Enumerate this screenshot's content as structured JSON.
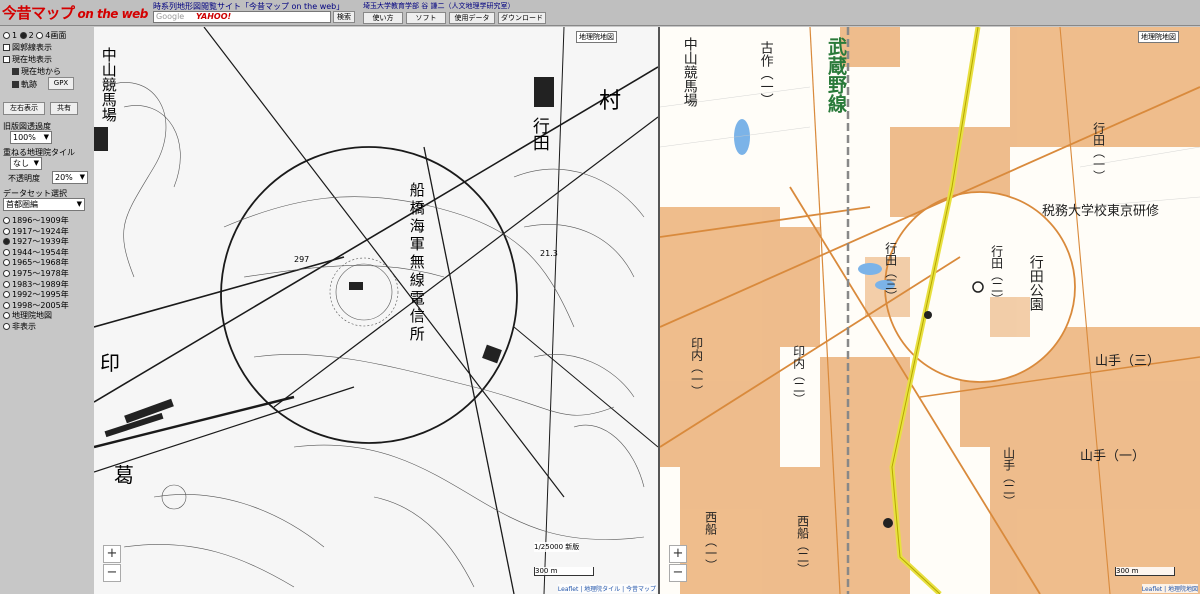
{
  "header": {
    "logo_main": "今昔マップ",
    "logo_sub": "on the web",
    "site_title": "時系列地形図閲覧サイト「今昔マップ on the web」",
    "search_logo_google": "Google",
    "search_logo_yahoo": "YAHOO!",
    "search_button": "検索",
    "credit": "埼玉大学教育学部 谷 謙二（人文地理学研究室）",
    "buttons": [
      "使い方",
      "ソフト",
      "使用データ",
      "ダウンロード"
    ]
  },
  "sidebar": {
    "layout_options": [
      "1",
      "2",
      "4画面"
    ],
    "layout_selected": 1,
    "checkboxes": [
      {
        "label": "図郭線表示",
        "checked": false
      },
      {
        "label": "現在地表示",
        "checked": false
      },
      {
        "label": "現在地から",
        "checked": true
      },
      {
        "label": "軌跡",
        "checked": true
      }
    ],
    "gpx_button": "GPX",
    "swap_button": "左右表示",
    "sync_button": "共有",
    "transparency_label": "旧版図透過度",
    "transparency_value": "100%",
    "overlay_label": "重ねる地理院タイル",
    "overlay_value": "なし",
    "opacity_label": "不透明度",
    "opacity_value": "20%",
    "dataset_label": "データセット選択",
    "dataset_value": "首都圏編",
    "eras": [
      "1896～1909年",
      "1917～1924年",
      "1927～1939年",
      "1944～1954年",
      "1965～1968年",
      "1975～1978年",
      "1983～1989年",
      "1992～1995年",
      "1998～2005年",
      "地理院地図",
      "非表示"
    ],
    "era_selected": 2
  },
  "map_left": {
    "tag": "地理院地図",
    "zoom_in": "+",
    "zoom_out": "−",
    "scale_text": "1/25000 新版",
    "scale_distance": "300 m",
    "attribution": "Leaflet | 地理院タイル | 今昔マップ",
    "place_names": {
      "nakayama_keiba": "中山競馬場",
      "mura": "村",
      "gyoden": "行田",
      "funabashi": "船橋海軍無線電信所",
      "in": "印",
      "katsu": "葛",
      "elev1": "297",
      "elev2": "21.3"
    }
  },
  "map_right": {
    "tag": "地理院地図",
    "zoom_in": "+",
    "zoom_out": "−",
    "scale_distance": "300 m",
    "attribution": "Leaflet | 地理院地図",
    "place_names": {
      "nakayama_keiba": "中山競馬場",
      "kosaku": "古作（一）",
      "musashino": "武蔵野線",
      "gyoden1": "行田（一）",
      "zeimu": "税務大学校東京研修",
      "gyoden3": "行田（三）",
      "gyoden_b": "行田（二）",
      "gyoden_park": "行田公園",
      "innai1": "印内（一）",
      "innai2": "印内（二）",
      "yamate3": "山手（三）",
      "yamate2": "山手（二）",
      "yamate1": "山手（一）",
      "nishifuna1": "西船（一）",
      "nishifuna2": "西船（二）"
    }
  },
  "colors": {
    "road": "#d98a3c",
    "building": "#e9a768",
    "rail": "#e8e040",
    "text_green": "#2a7a3a",
    "logo": "#d40000"
  }
}
